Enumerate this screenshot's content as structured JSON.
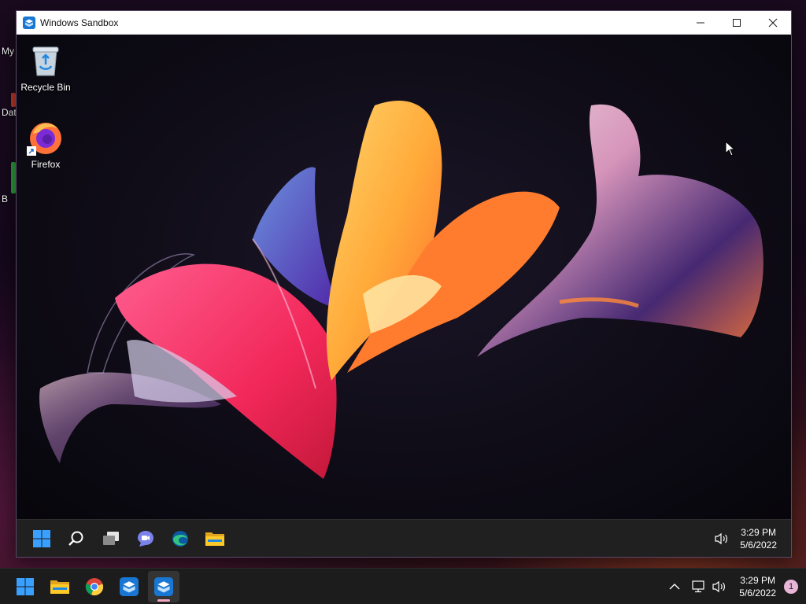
{
  "host": {
    "desktop_icons": [
      {
        "label": "My",
        "color": "#3a6fb0"
      },
      {
        "label": "Dat",
        "color": "#c0392b"
      },
      {
        "label": "B",
        "color": "#2e9e3f"
      }
    ],
    "taskbar": {
      "apps": [
        {
          "name": "start-button",
          "icon": "windows-logo-icon"
        },
        {
          "name": "file-explorer",
          "icon": "folder-icon"
        },
        {
          "name": "chrome",
          "icon": "chrome-icon"
        },
        {
          "name": "windows-sandbox",
          "icon": "sandbox-icon"
        },
        {
          "name": "windows-sandbox-running",
          "icon": "sandbox-icon"
        }
      ],
      "clock": {
        "time": "3:29 PM",
        "date": "5/6/2022"
      },
      "notification_count": "1"
    }
  },
  "sandbox": {
    "window_title": "Windows Sandbox",
    "controls": {
      "minimize": "minimize",
      "maximize": "maximize",
      "close": "close"
    },
    "desktop_icons": [
      {
        "label": "Recycle Bin",
        "icon": "recycle-bin-icon"
      },
      {
        "label": "Firefox",
        "icon": "firefox-icon"
      }
    ],
    "taskbar": {
      "apps": [
        "start",
        "search",
        "task-view",
        "chat",
        "edge",
        "file-explorer"
      ],
      "clock": {
        "time": "3:29 PM",
        "date": "5/6/2022"
      }
    }
  },
  "colors": {
    "accent_blue": "#0078d4",
    "taskbar": "#202020",
    "titlebar": "#ffffff"
  }
}
